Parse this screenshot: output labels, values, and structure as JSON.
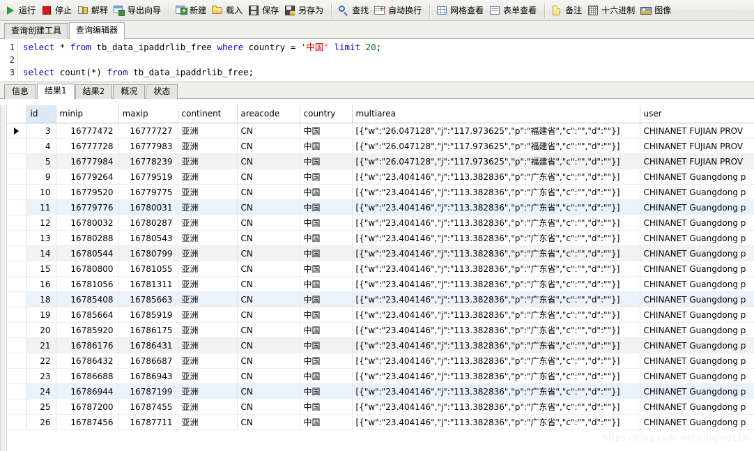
{
  "toolbar": {
    "groups": [
      [
        {
          "label": "运行",
          "icon": "run-icon",
          "icon_class": "ic-run"
        },
        {
          "label": "停止",
          "icon": "stop-icon",
          "icon_class": "ic-stop"
        },
        {
          "label": "解释",
          "icon": "explain-icon",
          "icon_class": "ic-explain"
        },
        {
          "label": "导出向导",
          "icon": "export-wizard-icon",
          "icon_class": "ic-export"
        }
      ],
      [
        {
          "label": "新建",
          "icon": "new-icon",
          "icon_class": "ic-new"
        },
        {
          "label": "载入",
          "icon": "load-folder-icon",
          "icon_class": "ic-load"
        },
        {
          "label": "保存",
          "icon": "save-icon",
          "icon_class": "ic-save"
        },
        {
          "label": "另存为",
          "icon": "save-as-icon",
          "icon_class": "ic-saveas"
        }
      ],
      [
        {
          "label": "查找",
          "icon": "search-icon",
          "icon_class": "ic-find"
        },
        {
          "label": "自动换行",
          "icon": "word-wrap-icon",
          "icon_class": "ic-wrap"
        }
      ],
      [
        {
          "label": "网格查看",
          "icon": "grid-view-icon",
          "icon_class": "ic-grid"
        },
        {
          "label": "表单查看",
          "icon": "form-view-icon",
          "icon_class": "ic-form"
        }
      ],
      [
        {
          "label": "备注",
          "icon": "note-icon",
          "icon_class": "ic-note"
        },
        {
          "label": "十六进制",
          "icon": "hex-icon",
          "icon_class": "ic-hex"
        },
        {
          "label": "图像",
          "icon": "image-icon",
          "icon_class": "ic-image"
        }
      ]
    ]
  },
  "query_tabs": [
    {
      "label": "查询创建工具",
      "active": false
    },
    {
      "label": "查询编辑器",
      "active": true
    }
  ],
  "editor": {
    "line_numbers": [
      "1",
      "2",
      "3"
    ],
    "lines": [
      [
        {
          "t": "select ",
          "c": "kw"
        },
        {
          "t": "* ",
          "c": "pln"
        },
        {
          "t": "from ",
          "c": "kw"
        },
        {
          "t": "tb_data_ipaddrlib_free ",
          "c": "pln"
        },
        {
          "t": "where ",
          "c": "kw"
        },
        {
          "t": "country = ",
          "c": "pln"
        },
        {
          "t": "'中国' ",
          "c": "str"
        },
        {
          "t": "limit ",
          "c": "kw"
        },
        {
          "t": "20",
          "c": "num"
        },
        {
          "t": ";",
          "c": "pln"
        }
      ],
      [],
      [
        {
          "t": "select ",
          "c": "kw"
        },
        {
          "t": "count(*) ",
          "c": "pln"
        },
        {
          "t": "from ",
          "c": "kw"
        },
        {
          "t": "tb_data_ipaddrlib_free;",
          "c": "pln"
        }
      ]
    ]
  },
  "result_tabs": [
    {
      "label": "信息",
      "active": false
    },
    {
      "label": "结果1",
      "active": true
    },
    {
      "label": "结果2",
      "active": false
    },
    {
      "label": "概况",
      "active": false
    },
    {
      "label": "状态",
      "active": false
    }
  ],
  "grid": {
    "columns": [
      {
        "key": "id",
        "label": "id",
        "highlight": true
      },
      {
        "key": "minip",
        "label": "minip",
        "highlight": false
      },
      {
        "key": "maxip",
        "label": "maxip",
        "highlight": false
      },
      {
        "key": "continent",
        "label": "continent",
        "highlight": false
      },
      {
        "key": "areacode",
        "label": "areacode",
        "highlight": false
      },
      {
        "key": "country",
        "label": "country",
        "highlight": false
      },
      {
        "key": "multiarea",
        "label": "multiarea",
        "highlight": false
      },
      {
        "key": "user",
        "label": "user",
        "highlight": false
      }
    ],
    "multiarea_fujian": "[{\"w\":\"26.047128\",\"j\":\"117.973625\",\"p\":\"福建省\",\"c\":\"\",\"d\":\"\"}]",
    "multiarea_guangdong": "[{\"w\":\"23.404146\",\"j\":\"113.382836\",\"p\":\"广东省\",\"c\":\"\",\"d\":\"\"}]",
    "user_fujian": "CHINANET FUJIAN PROV",
    "user_guangdong": "CHINANET Guangdong p",
    "rows": [
      {
        "selected": true,
        "stripe": "",
        "id": "3",
        "minip": "16777472",
        "maxip": "16777727",
        "continent": "亚洲",
        "areacode": "CN",
        "country": "中国",
        "multiarea": "[{\"w\":\"26.047128\",\"j\":\"117.973625\",\"p\":\"福建省\",\"c\":\"\",\"d\":\"\"}]",
        "user": "CHINANET FUJIAN PROV"
      },
      {
        "selected": false,
        "stripe": "",
        "id": "4",
        "minip": "16777728",
        "maxip": "16777983",
        "continent": "亚洲",
        "areacode": "CN",
        "country": "中国",
        "multiarea": "[{\"w\":\"26.047128\",\"j\":\"117.973625\",\"p\":\"福建省\",\"c\":\"\",\"d\":\"\"}]",
        "user": "CHINANET FUJIAN PROV"
      },
      {
        "selected": false,
        "stripe": "alt-gray",
        "id": "5",
        "minip": "16777984",
        "maxip": "16778239",
        "continent": "亚洲",
        "areacode": "CN",
        "country": "中国",
        "multiarea": "[{\"w\":\"26.047128\",\"j\":\"117.973625\",\"p\":\"福建省\",\"c\":\"\",\"d\":\"\"}]",
        "user": "CHINANET FUJIAN PROV"
      },
      {
        "selected": false,
        "stripe": "",
        "id": "9",
        "minip": "16779264",
        "maxip": "16779519",
        "continent": "亚洲",
        "areacode": "CN",
        "country": "中国",
        "multiarea": "[{\"w\":\"23.404146\",\"j\":\"113.382836\",\"p\":\"广东省\",\"c\":\"\",\"d\":\"\"}]",
        "user": "CHINANET Guangdong p"
      },
      {
        "selected": false,
        "stripe": "",
        "id": "10",
        "minip": "16779520",
        "maxip": "16779775",
        "continent": "亚洲",
        "areacode": "CN",
        "country": "中国",
        "multiarea": "[{\"w\":\"23.404146\",\"j\":\"113.382836\",\"p\":\"广东省\",\"c\":\"\",\"d\":\"\"}]",
        "user": "CHINANET Guangdong p"
      },
      {
        "selected": false,
        "stripe": "alt-blue",
        "id": "11",
        "minip": "16779776",
        "maxip": "16780031",
        "continent": "亚洲",
        "areacode": "CN",
        "country": "中国",
        "multiarea": "[{\"w\":\"23.404146\",\"j\":\"113.382836\",\"p\":\"广东省\",\"c\":\"\",\"d\":\"\"}]",
        "user": "CHINANET Guangdong p"
      },
      {
        "selected": false,
        "stripe": "",
        "id": "12",
        "minip": "16780032",
        "maxip": "16780287",
        "continent": "亚洲",
        "areacode": "CN",
        "country": "中国",
        "multiarea": "[{\"w\":\"23.404146\",\"j\":\"113.382836\",\"p\":\"广东省\",\"c\":\"\",\"d\":\"\"}]",
        "user": "CHINANET Guangdong p"
      },
      {
        "selected": false,
        "stripe": "",
        "id": "13",
        "minip": "16780288",
        "maxip": "16780543",
        "continent": "亚洲",
        "areacode": "CN",
        "country": "中国",
        "multiarea": "[{\"w\":\"23.404146\",\"j\":\"113.382836\",\"p\":\"广东省\",\"c\":\"\",\"d\":\"\"}]",
        "user": "CHINANET Guangdong p"
      },
      {
        "selected": false,
        "stripe": "alt-gray",
        "id": "14",
        "minip": "16780544",
        "maxip": "16780799",
        "continent": "亚洲",
        "areacode": "CN",
        "country": "中国",
        "multiarea": "[{\"w\":\"23.404146\",\"j\":\"113.382836\",\"p\":\"广东省\",\"c\":\"\",\"d\":\"\"}]",
        "user": "CHINANET Guangdong p"
      },
      {
        "selected": false,
        "stripe": "",
        "id": "15",
        "minip": "16780800",
        "maxip": "16781055",
        "continent": "亚洲",
        "areacode": "CN",
        "country": "中国",
        "multiarea": "[{\"w\":\"23.404146\",\"j\":\"113.382836\",\"p\":\"广东省\",\"c\":\"\",\"d\":\"\"}]",
        "user": "CHINANET Guangdong p"
      },
      {
        "selected": false,
        "stripe": "",
        "id": "16",
        "minip": "16781056",
        "maxip": "16781311",
        "continent": "亚洲",
        "areacode": "CN",
        "country": "中国",
        "multiarea": "[{\"w\":\"23.404146\",\"j\":\"113.382836\",\"p\":\"广东省\",\"c\":\"\",\"d\":\"\"}]",
        "user": "CHINANET Guangdong p"
      },
      {
        "selected": false,
        "stripe": "alt-blue",
        "id": "18",
        "minip": "16785408",
        "maxip": "16785663",
        "continent": "亚洲",
        "areacode": "CN",
        "country": "中国",
        "multiarea": "[{\"w\":\"23.404146\",\"j\":\"113.382836\",\"p\":\"广东省\",\"c\":\"\",\"d\":\"\"}]",
        "user": "CHINANET Guangdong p"
      },
      {
        "selected": false,
        "stripe": "",
        "id": "19",
        "minip": "16785664",
        "maxip": "16785919",
        "continent": "亚洲",
        "areacode": "CN",
        "country": "中国",
        "multiarea": "[{\"w\":\"23.404146\",\"j\":\"113.382836\",\"p\":\"广东省\",\"c\":\"\",\"d\":\"\"}]",
        "user": "CHINANET Guangdong p"
      },
      {
        "selected": false,
        "stripe": "",
        "id": "20",
        "minip": "16785920",
        "maxip": "16786175",
        "continent": "亚洲",
        "areacode": "CN",
        "country": "中国",
        "multiarea": "[{\"w\":\"23.404146\",\"j\":\"113.382836\",\"p\":\"广东省\",\"c\":\"\",\"d\":\"\"}]",
        "user": "CHINANET Guangdong p"
      },
      {
        "selected": false,
        "stripe": "alt-gray",
        "id": "21",
        "minip": "16786176",
        "maxip": "16786431",
        "continent": "亚洲",
        "areacode": "CN",
        "country": "中国",
        "multiarea": "[{\"w\":\"23.404146\",\"j\":\"113.382836\",\"p\":\"广东省\",\"c\":\"\",\"d\":\"\"}]",
        "user": "CHINANET Guangdong p"
      },
      {
        "selected": false,
        "stripe": "",
        "id": "22",
        "minip": "16786432",
        "maxip": "16786687",
        "continent": "亚洲",
        "areacode": "CN",
        "country": "中国",
        "multiarea": "[{\"w\":\"23.404146\",\"j\":\"113.382836\",\"p\":\"广东省\",\"c\":\"\",\"d\":\"\"}]",
        "user": "CHINANET Guangdong p"
      },
      {
        "selected": false,
        "stripe": "",
        "id": "23",
        "minip": "16786688",
        "maxip": "16786943",
        "continent": "亚洲",
        "areacode": "CN",
        "country": "中国",
        "multiarea": "[{\"w\":\"23.404146\",\"j\":\"113.382836\",\"p\":\"广东省\",\"c\":\"\",\"d\":\"\"}]",
        "user": "CHINANET Guangdong p"
      },
      {
        "selected": false,
        "stripe": "alt-blue",
        "id": "24",
        "minip": "16786944",
        "maxip": "16787199",
        "continent": "亚洲",
        "areacode": "CN",
        "country": "中国",
        "multiarea": "[{\"w\":\"23.404146\",\"j\":\"113.382836\",\"p\":\"广东省\",\"c\":\"\",\"d\":\"\"}]",
        "user": "CHINANET Guangdong p"
      },
      {
        "selected": false,
        "stripe": "",
        "id": "25",
        "minip": "16787200",
        "maxip": "16787455",
        "continent": "亚洲",
        "areacode": "CN",
        "country": "中国",
        "multiarea": "[{\"w\":\"23.404146\",\"j\":\"113.382836\",\"p\":\"广东省\",\"c\":\"\",\"d\":\"\"}]",
        "user": "CHINANET Guangdong p"
      },
      {
        "selected": false,
        "stripe": "",
        "id": "26",
        "minip": "16787456",
        "maxip": "16787711",
        "continent": "亚洲",
        "areacode": "CN",
        "country": "中国",
        "multiarea": "[{\"w\":\"23.404146\",\"j\":\"113.382836\",\"p\":\"广东省\",\"c\":\"\",\"d\":\"\"}]",
        "user": "CHINANET Guangdong p"
      }
    ]
  },
  "watermark": {
    "text": "https://blog.csdn.net/caiqing116"
  },
  "colors": {
    "keyword": "#0000cd",
    "string": "#c00000",
    "number": "#008000",
    "header_highlight": "#dceaf7",
    "stripe_gray": "#f2f2f0",
    "stripe_blue": "#eaf2fb"
  }
}
